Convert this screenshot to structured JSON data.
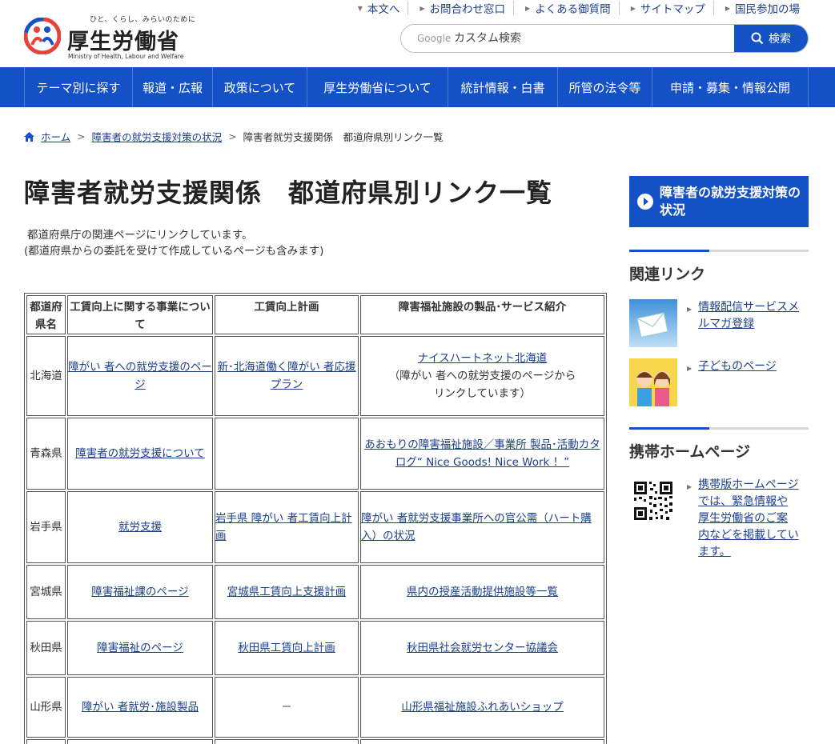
{
  "header": {
    "tagline": "ひと、くらし、みらいのために",
    "title": "厚生労働省",
    "title_en": "Ministry of Health, Labour and Welfare",
    "utility_links": [
      "本文へ",
      "お問合わせ窓口",
      "よくある御質問",
      "サイトマップ",
      "国民参加の場"
    ],
    "search": {
      "engine_label": "Google",
      "placeholder": "カスタム検索",
      "button_label": "検索"
    }
  },
  "nav": {
    "items": [
      "テーマ別に探す",
      "報道・広報",
      "政策について",
      "厚生労働省について",
      "統計情報・白書",
      "所管の法令等",
      "申請・募集・情報公開"
    ]
  },
  "breadcrumb": [
    "ホーム",
    "障害者の就労支援対策の状況",
    "障害者就労支援関係　都道府県別リンク一覧"
  ],
  "page_title": "障害者就労支援関係　都道府県別リンク一覧",
  "intro": {
    "line1": "都道府県庁の関連ページにリンクしています。",
    "line2": "(都道府県からの委託を受けて作成しているページも含みます)"
  },
  "table": {
    "headers": [
      "都道府県名",
      "工賃向上に関する事業について",
      "工賃向上計画",
      "障害福祉施設の製品･サービス紹介"
    ],
    "rows": [
      {
        "pref": "北海道",
        "c1": "障がい 者への就労支援のページ",
        "c2": "新･北海道働く障がい 者応援プラン",
        "c3": "ナイスハートネット北海道",
        "c3_note": "（障がい 者への就労支援のページからリンクしています）"
      },
      {
        "pref": "青森県",
        "c1": "障害者の就労支援について",
        "c2": "",
        "c3": "あおもりの障害福祉施設／事業所 製品･活動カタログ“ Nice Goods! Nice Work ！”",
        "c3_note": ""
      },
      {
        "pref": "岩手県",
        "c1": "就労支援",
        "c2": "岩手県 障がい 者工賃向上計画",
        "c3": "障がい 者就労支援事業所への官公需（ハート購入）の状況",
        "c3_note": ""
      },
      {
        "pref": "宮城県",
        "c1": "障害福祉課のページ",
        "c2": "宮城県工賃向上支援計画",
        "c3": "県内の授産活動提供施設等一覧",
        "c3_note": ""
      },
      {
        "pref": "秋田県",
        "c1": "障害福祉のページ",
        "c2": "秋田県工賃向上計画",
        "c3": "秋田県社会就労センター協議会",
        "c3_note": ""
      },
      {
        "pref": "山形県",
        "c1": "障がい 者就労･施設製品",
        "c2": "－",
        "c3": "山形県福祉施設ふれあいショップ",
        "c3_note": ""
      }
    ]
  },
  "sidebar": {
    "banner": "障害者の就労支援対策の状況",
    "related_heading": "関連リンク",
    "related_links": [
      "情報配信サービスメルマガ登録",
      "子どものページ"
    ],
    "mobile_heading": "携帯ホームページ",
    "mobile_text": "携帯版ホームページでは、緊急情報や厚生労働省のご案内などを掲載しています。"
  },
  "colors": {
    "brand_blue": "#1451c6",
    "link": "#1b3f8a"
  }
}
